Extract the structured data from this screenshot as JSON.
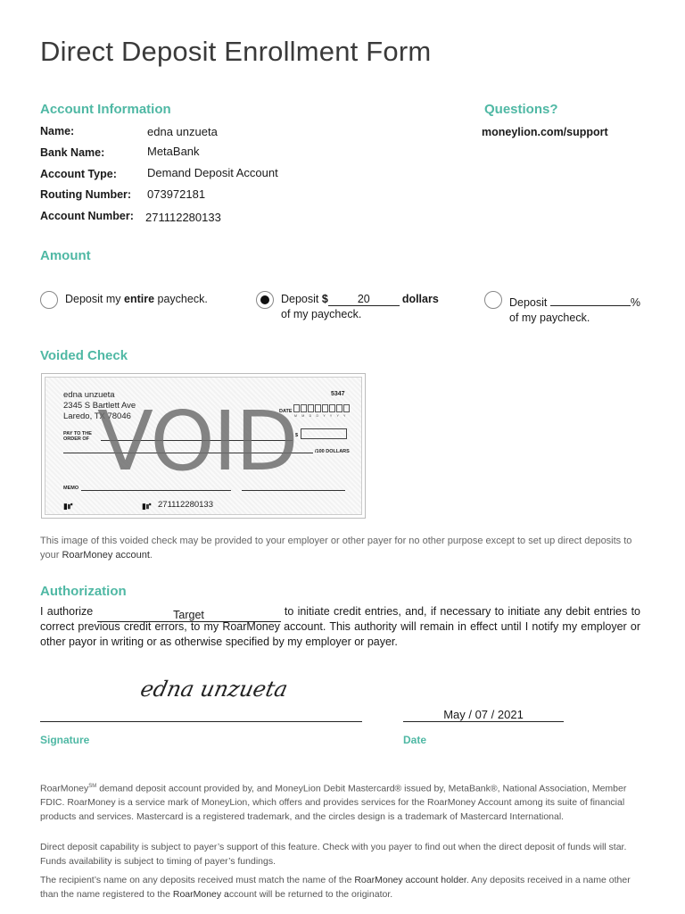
{
  "title": "Direct Deposit Enrollment Form",
  "account_info": {
    "heading": "Account Information",
    "fields": [
      {
        "label": "Name:",
        "value": "edna unzueta"
      },
      {
        "label": "Bank Name:",
        "value": "MetaBank"
      },
      {
        "label": "Account Type:",
        "value": "Demand Deposit Account"
      },
      {
        "label": "Routing Number:",
        "value": "073972181"
      },
      {
        "label": "Account Number:",
        "value": "271112280133"
      }
    ]
  },
  "questions": {
    "heading": "Questions?",
    "link": "moneylion.com/support"
  },
  "amount": {
    "heading": "Amount",
    "option1": {
      "pre": "Deposit my ",
      "bold": "entire",
      "post": " paycheck.",
      "selected": false
    },
    "option2": {
      "pre": "Deposit ",
      "dollar_sign": "$",
      "value": "20",
      "post": "dollars",
      "line2": "of my paycheck.",
      "selected": true
    },
    "option3": {
      "pre": "Deposit ",
      "value": "",
      "post": "%",
      "line2": "of my paycheck.",
      "selected": false
    }
  },
  "voided_check": {
    "heading": "Voided Check",
    "name": "edna unzueta",
    "address1": "2345 S Bartlett Ave",
    "address2": "Laredo, TX 78046",
    "check_number": "5347",
    "date_label": "DATE",
    "date_sub": "M M D D Y Y Y Y",
    "pay_to_1": "PAY TO THE",
    "pay_to_2": "ORDER OF",
    "dollar_sign": "$",
    "dollars_label": "/100 DOLLARS",
    "memo_label": "MEMO",
    "micr_account": "271112280133",
    "watermark": "VOID"
  },
  "check_note": {
    "text": "This image of this voided check may be provided to your employer or other payer for no other purpose except to set up direct deposits to your ",
    "brand": "RoarMoney account",
    "end": "."
  },
  "authorization": {
    "heading": "Authorization",
    "pre": "I authorize",
    "payer": "Target",
    "text1": " to initiate credit entries, and, if necessary to initiate any debit entries to correct previous credit errors, to my ",
    "brand": "RoarMoney account",
    "text2": ". This authority will remain in effect until I notify my employer or other payor in writing or as otherwise specified by my employer or payer."
  },
  "signature": {
    "label": "Signature",
    "script": "edna unzueta"
  },
  "date": {
    "label": "Date",
    "value": "May / 07 / 2021"
  },
  "footer": {
    "p1a": "RoarMoney",
    "p1sm": "SM",
    "p1b": " demand deposit account provided by, and MoneyLion Debit Mastercard® issued by, MetaBank®, National Association, Member FDIC. RoarMoney is a service mark of MoneyLion, which offers and provides services for the RoarMoney Account among its suite of financial products and services. Mastercard is a registered trademark, and the circles design is a trademark of Mastercard International.",
    "p2": "Direct deposit capability is subject to payer’s support of this feature. Check with you payer to find out when the direct deposit of funds will star. Funds availability is subject to timing of payer’s fundings.",
    "p3a": "The recipient’s name on any deposits received must match the name of the ",
    "p3brand": "RoarMoney account holder",
    "p3b": ". Any deposits received in a name other than the name registered to the ",
    "p3brand2": "RoarMoney a",
    "p3c": "ccount will be returned to the originator."
  },
  "colors": {
    "accent": "#4fb8a4",
    "text": "#1a1a1a",
    "muted": "#666666"
  }
}
